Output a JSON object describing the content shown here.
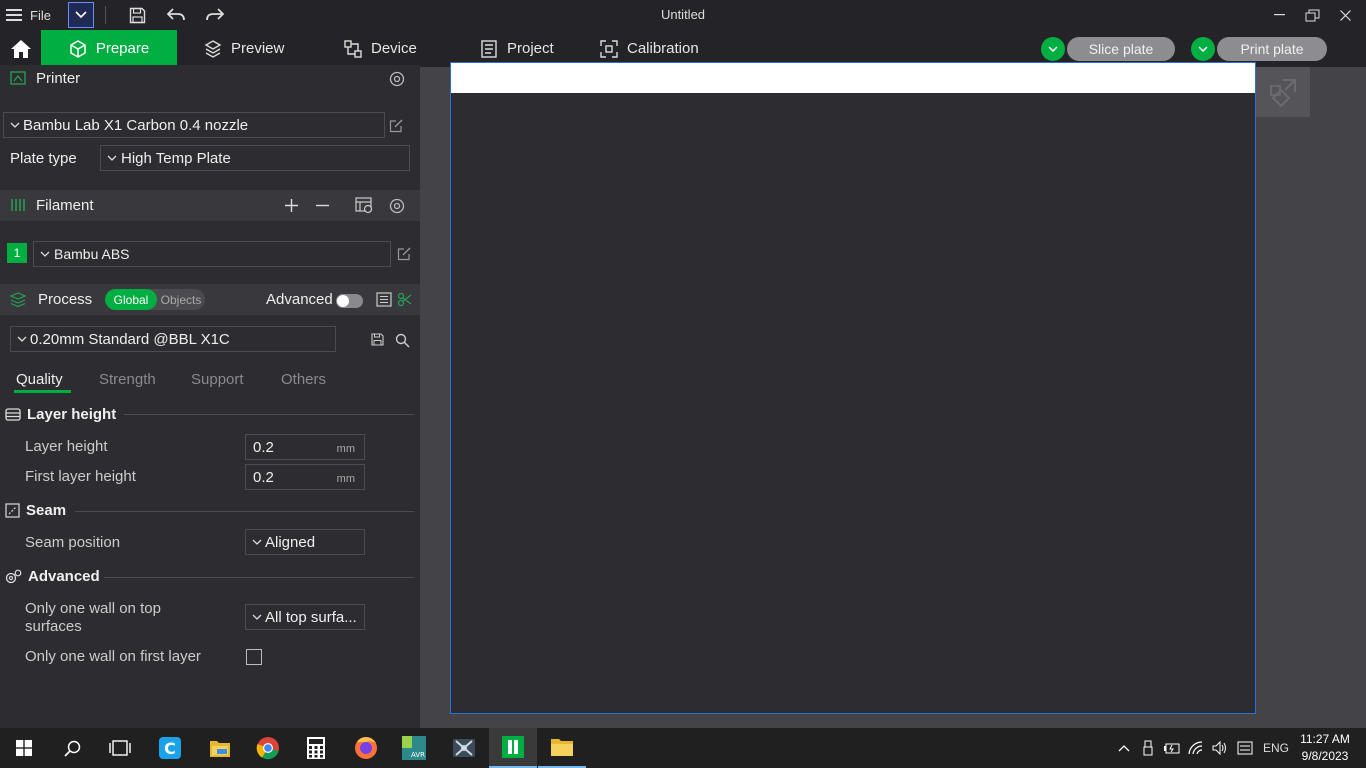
{
  "app": {
    "menu_label": "File",
    "window_title": "Untitled"
  },
  "tabs": [
    {
      "label": "Prepare",
      "icon": "cube-icon"
    },
    {
      "label": "Preview",
      "icon": "layers-icon"
    },
    {
      "label": "Device",
      "icon": "device-icon"
    },
    {
      "label": "Project",
      "icon": "project-icon"
    },
    {
      "label": "Calibration",
      "icon": "calibration-icon"
    }
  ],
  "actions": {
    "slice_label": "Slice plate",
    "print_label": "Print plate"
  },
  "printer": {
    "section_title": "Printer",
    "preset": "Bambu Lab X1 Carbon 0.4 nozzle",
    "plate_type_label": "Plate type",
    "plate_type_value": "High Temp Plate"
  },
  "filament": {
    "section_title": "Filament",
    "slot_number": "1",
    "slot_color": "#00ae42",
    "value": "Bambu ABS"
  },
  "process": {
    "section_title": "Process",
    "toggle_global": "Global",
    "toggle_objects": "Objects",
    "advanced_label": "Advanced",
    "advanced_on": false,
    "preset": "0.20mm Standard @BBL X1C",
    "subtabs": [
      "Quality",
      "Strength",
      "Support",
      "Others"
    ],
    "active_subtab": "Quality"
  },
  "quality": {
    "layer_height_group": "Layer height",
    "layer_height_label": "Layer height",
    "layer_height_value": "0.2",
    "first_layer_height_label": "First layer height",
    "first_layer_height_value": "0.2",
    "unit": "mm",
    "seam_group": "Seam",
    "seam_position_label": "Seam position",
    "seam_position_value": "Aligned",
    "advanced_group": "Advanced",
    "one_wall_top_label_1": "Only one wall on top",
    "one_wall_top_label_2": "surfaces",
    "one_wall_top_value": "All top surfa...",
    "one_wall_first_label": "Only one wall on first layer",
    "one_wall_first_checked": false
  },
  "colors": {
    "accent": "#00ae42",
    "panel": "#2d2d31",
    "selection_border": "#2c6fd6"
  },
  "taskbar": {
    "time": "11:27 AM",
    "date": "9/8/2023",
    "language": "ENG"
  }
}
